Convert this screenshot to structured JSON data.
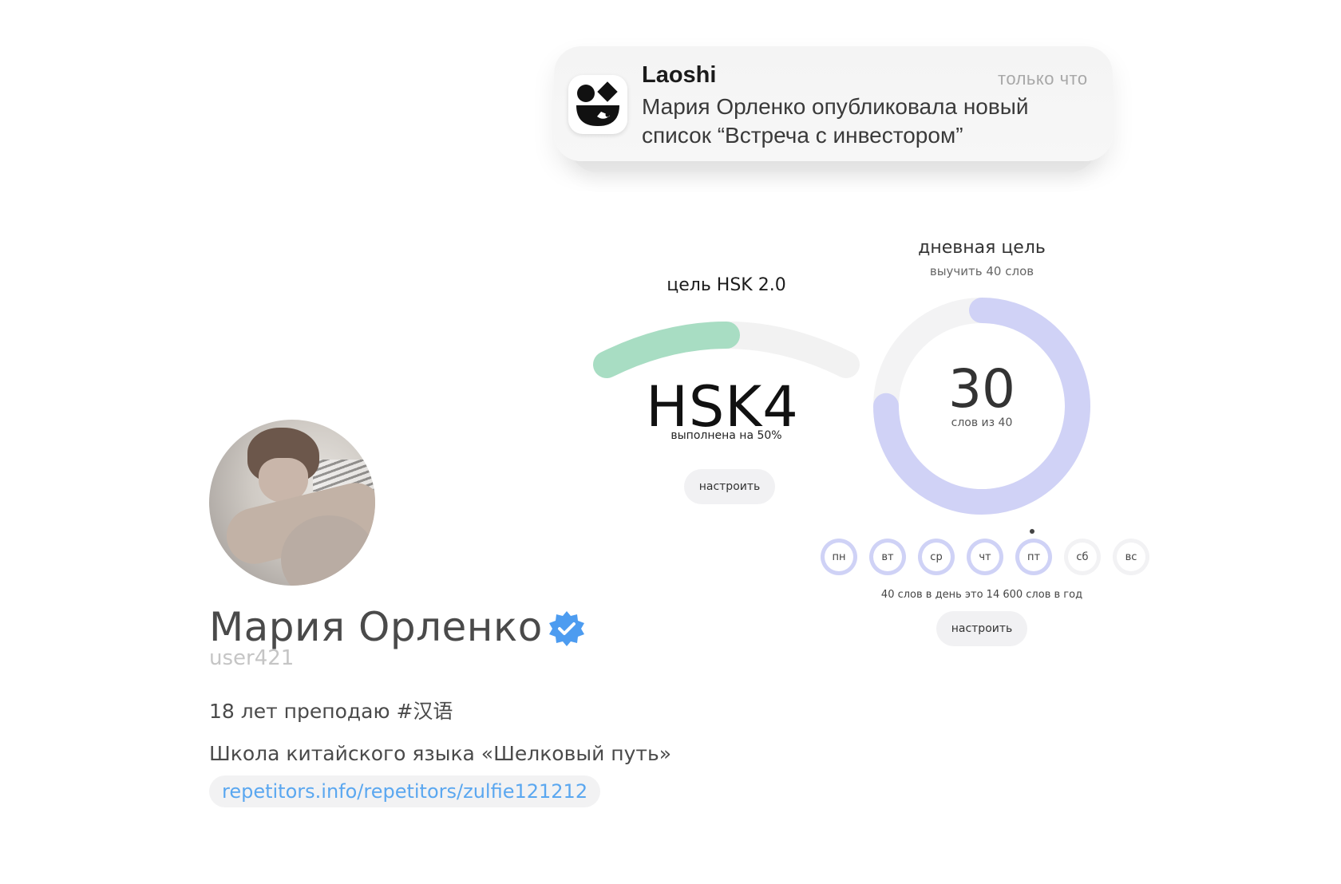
{
  "notification": {
    "app_name": "Laoshi",
    "time": "только что",
    "message": "Мария Орленко опубликовала новый список “Встреча с инвестором”",
    "icon": "laoshi-logo-icon"
  },
  "hsk_goal": {
    "title": "цель HSK 2.0",
    "level": "HSK4",
    "progress_text": "выполнена на 50%",
    "progress": 0.5,
    "button_label": "настроить",
    "accent_color": "#a8ddc3",
    "track_color": "#f2f2f2"
  },
  "daily_goal": {
    "title": "дневная цель",
    "subtitle": "выучить 40 слов",
    "count": "30",
    "count_sub": "слов из 40",
    "progress": 0.75,
    "accent_color": "#d0d2f6",
    "days": [
      {
        "label": "пн",
        "done": true
      },
      {
        "label": "вт",
        "done": true
      },
      {
        "label": "ср",
        "done": true
      },
      {
        "label": "чт",
        "done": true
      },
      {
        "label": "пт",
        "done": true
      },
      {
        "label": "сб",
        "done": false
      },
      {
        "label": "вс",
        "done": false
      }
    ],
    "year_note": "40 слов в день это 14 600 слов в год",
    "button_label": "настроить"
  },
  "profile": {
    "name": "Мария Орленко",
    "username": "user421",
    "verified_icon": "verified-badge-icon",
    "bio": "18 лет преподаю #汉语",
    "school": "Школа китайского языка «Шелковый путь»",
    "link": "repetitors.info/repetitors/zulfie121212",
    "link_color": "#5aa7f0"
  }
}
